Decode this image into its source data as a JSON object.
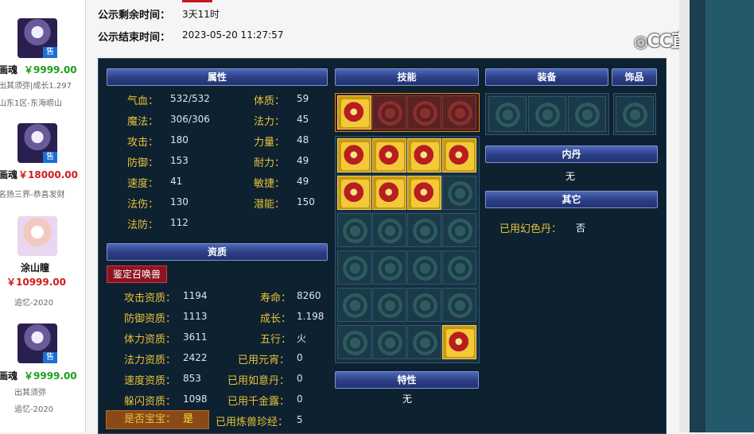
{
  "left_list": [
    {
      "name": "画魂",
      "price": "￥9999.00",
      "sub1": "出其须弥|成长1.297",
      "sub2": "山东1区-东海崂山",
      "tag": "售"
    },
    {
      "name": "画魂",
      "price": "￥18000.00",
      "sub1": "名扬三界-恭喜发财",
      "tag": "售"
    },
    {
      "name": "涂山瞳",
      "price": "￥10999.00",
      "sub1": "追忆-2020"
    },
    {
      "name": "画魂",
      "price": "￥9999.00",
      "sub1": "出其须弥",
      "sub2": "追忆-2020",
      "tag": "售"
    }
  ],
  "top_info": {
    "remaining_label": "公示剩余时间：",
    "remaining_value": "3天11时",
    "end_label": "公示结束时间：",
    "end_value": "2023-05-20 11:27:57"
  },
  "watermark": "CC直播",
  "headers": {
    "attr": "属性",
    "skills": "技能",
    "equip": "装备",
    "accessory": "饰品",
    "neidan": "内丹",
    "other": "其它",
    "aptitude": "资质",
    "trait": "特性"
  },
  "attrs_left": [
    {
      "label": "气血：",
      "value": "532/532"
    },
    {
      "label": "魔法：",
      "value": "306/306"
    },
    {
      "label": "攻击：",
      "value": "180"
    },
    {
      "label": "防御：",
      "value": "153"
    },
    {
      "label": "速度：",
      "value": "41"
    },
    {
      "label": "法伤：",
      "value": "130"
    },
    {
      "label": "法防：",
      "value": "112"
    }
  ],
  "attrs_right": [
    {
      "label": "体质：",
      "value": "59"
    },
    {
      "label": "法力：",
      "value": "45"
    },
    {
      "label": "力量：",
      "value": "48"
    },
    {
      "label": "耐力：",
      "value": "49"
    },
    {
      "label": "敏捷：",
      "value": "49"
    },
    {
      "label": "潜能：",
      "value": "150"
    }
  ],
  "identify_button": "鉴定召唤兽",
  "apt_left": [
    {
      "label": "攻击资质：",
      "value": "1194"
    },
    {
      "label": "防御资质：",
      "value": "1113"
    },
    {
      "label": "体力资质：",
      "value": "3611"
    },
    {
      "label": "法力资质：",
      "value": "2422"
    },
    {
      "label": "速度资质：",
      "value": "853"
    },
    {
      "label": "躲闪资质：",
      "value": "1098"
    }
  ],
  "apt_right": [
    {
      "label": "寿命：",
      "value": "8260"
    },
    {
      "label": "成长：",
      "value": "1.198"
    },
    {
      "label": "五行：",
      "value": "火"
    },
    {
      "label": "已用元宵：",
      "value": "0"
    },
    {
      "label": "已用如意丹：",
      "value": "0"
    },
    {
      "label": "已用千金露：",
      "value": "0"
    },
    {
      "label": "已用炼兽珍经：",
      "value": "5"
    }
  ],
  "baby": {
    "label": "是否宝宝：",
    "value": "是"
  },
  "neidan_value": "无",
  "other": {
    "label": "已用幻色丹：",
    "value": "否"
  },
  "trait_value": "无"
}
